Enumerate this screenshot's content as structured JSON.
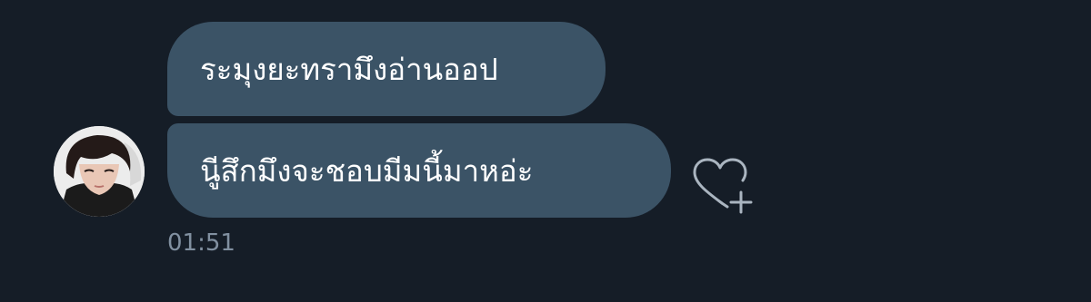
{
  "messages": [
    {
      "text": "ระมุงยะทรามึงอ่านออป"
    },
    {
      "text": "นูีสึกมึงจะชอบมีมนี้มาหอ่ะ"
    }
  ],
  "timestamp": "01:51",
  "icons": {
    "avatar": "contact-avatar",
    "react": "heart-plus-icon"
  },
  "colors": {
    "background": "#151d27",
    "bubble": "#3b5366",
    "bubble_text": "#ffffff",
    "timestamp": "#8190a0",
    "icon": "#aab5c0"
  }
}
